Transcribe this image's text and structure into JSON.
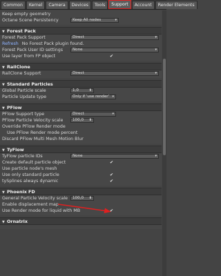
{
  "tabs": [
    "Common",
    "Kernel",
    "Camera",
    "Devices",
    "Tools",
    "Support",
    "Account",
    "Render Elements"
  ],
  "top": {
    "keep_empty_geometry": "Keep empty geometry",
    "octane_scene_persistency": "Octane Scene Persistency",
    "persistency_value": "Keep All nodes"
  },
  "forest_pack": {
    "title": "Forest Pack",
    "support_label": "Forest Pack Support",
    "support_value": "Direct",
    "refresh": "Refresh",
    "not_found": "No Forest Pack plugin found.",
    "user_id_label": "Forest Pack User ID settings",
    "user_id_value": "None",
    "use_layer_label": "Use layer from FP object"
  },
  "railclone": {
    "title": "RailClone",
    "support_label": "RailClone Support",
    "support_value": "Direct"
  },
  "standard_particles": {
    "title": "Standard Particles",
    "global_scale_label": "Global Particle scale",
    "global_scale_value": "1,0",
    "update_type_label": "Particle Update type",
    "update_type_value": "Only if 'use render'"
  },
  "pflow": {
    "title": "PFlow",
    "support_label": "PFlow Support type",
    "support_value": "Direct",
    "velocity_label": "PFlow Particle Velocity scale",
    "velocity_value": "100,0",
    "override_label": "Override PFlow Render mode",
    "use_percent_label": "Use PFlow Render mode percent",
    "discard_label": "Discard PFlow Multi Mesh Motion Blur"
  },
  "tyflow": {
    "title": "TyFlow",
    "ids_label": "TyFlow particle IDs",
    "ids_value": "None",
    "create_default_label": "Create default particle object",
    "use_mesh_label": "Use particle node's mesh",
    "use_standard_label": "Use only standard particle",
    "splines_label": "tySplines always dynamic"
  },
  "phoenix": {
    "title": "Phoenix FD",
    "velocity_label": "General Particle Velocity scale",
    "velocity_value": "100,0",
    "displacement_label": "Enable displacement map",
    "render_mode_label": "Use Render mode for liquid with MB"
  },
  "ornatrix": {
    "title": "Ornatrix"
  },
  "colors": {
    "annotation": "#e02020",
    "panel": "#474747",
    "header": "#3c3c3c"
  }
}
